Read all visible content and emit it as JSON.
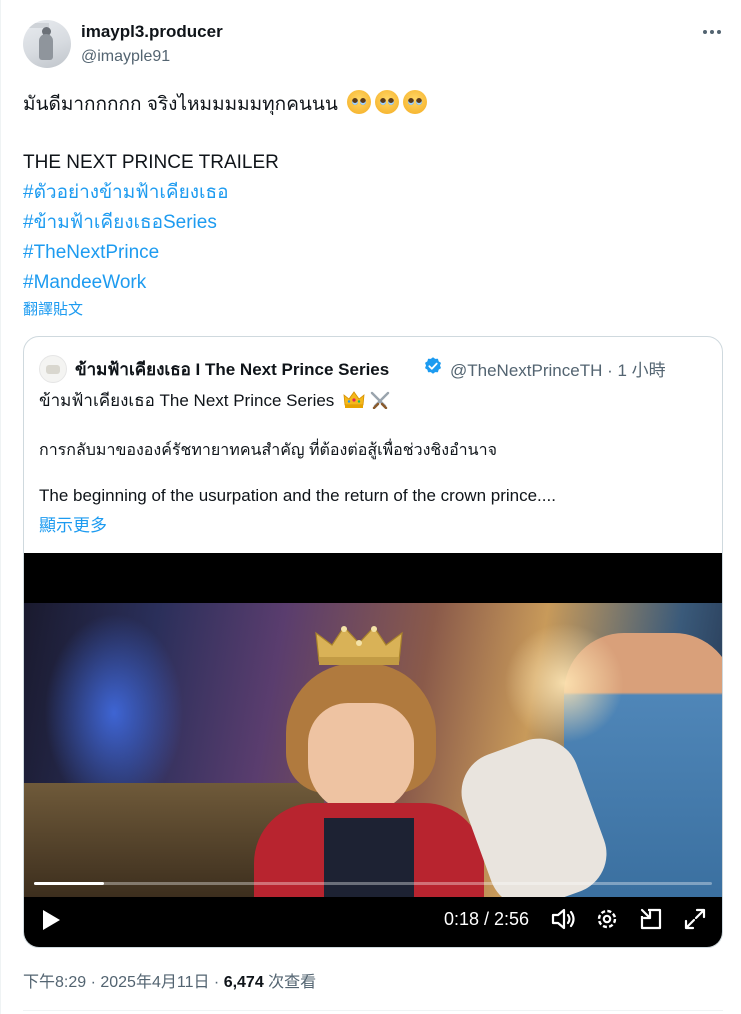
{
  "author": {
    "display_name": "imaypl3.producer",
    "handle": "@imayple91",
    "avatar_icon": "profile-photo"
  },
  "more_icon": "more-horizontal-icon",
  "post": {
    "line1": "มันดีมากกกกก จริงไหมมมมมทุกคนนน",
    "line1_emojis": [
      "face-holding-back-tears-emoji",
      "face-holding-back-tears-emoji",
      "face-holding-back-tears-emoji"
    ],
    "title_line": "THE NEXT PRINCE TRAILER",
    "hashtags": [
      "#ตัวอย่างข้ามฟ้าเคียงเธอ",
      "#ข้ามฟ้าเคียงเธอSeries",
      "#TheNextPrince",
      "#MandeeWork"
    ]
  },
  "translate_label": "翻譯貼文",
  "quote": {
    "name": "ข้ามฟ้าเคียงเธอ I The Next Prince Series",
    "verified": true,
    "handle_time": "@TheNextPrinceTH · 1 小時",
    "line1": "ข้ามฟ้าเคียงเธอ The Next Prince Series",
    "line1_emojis": [
      "crown-emoji",
      "crossed-swords-emoji"
    ],
    "line2": "การกลับมาขององค์รัชทายาทคนสำคัญ ที่ต้องต่อสู้เพื่อช่วงชิงอำนาจ",
    "line3": "The beginning of the usurpation and the return of the crown prince....",
    "show_more": "顯示更多",
    "video": {
      "time": "0:18 / 2:56",
      "progress": 0.103,
      "controls": [
        "play-icon",
        "volume-icon",
        "settings-icon",
        "pip-icon",
        "fullscreen-icon"
      ]
    }
  },
  "meta": {
    "timestamp": "下午8:29 · 2025年4月11日 · ",
    "views_count": "6,474",
    "views_label": " 次查看"
  },
  "colors": {
    "link": "#1d9bf0",
    "secondary_text": "#536471",
    "primary_text": "#0f1419",
    "border": "#cfd9de"
  }
}
